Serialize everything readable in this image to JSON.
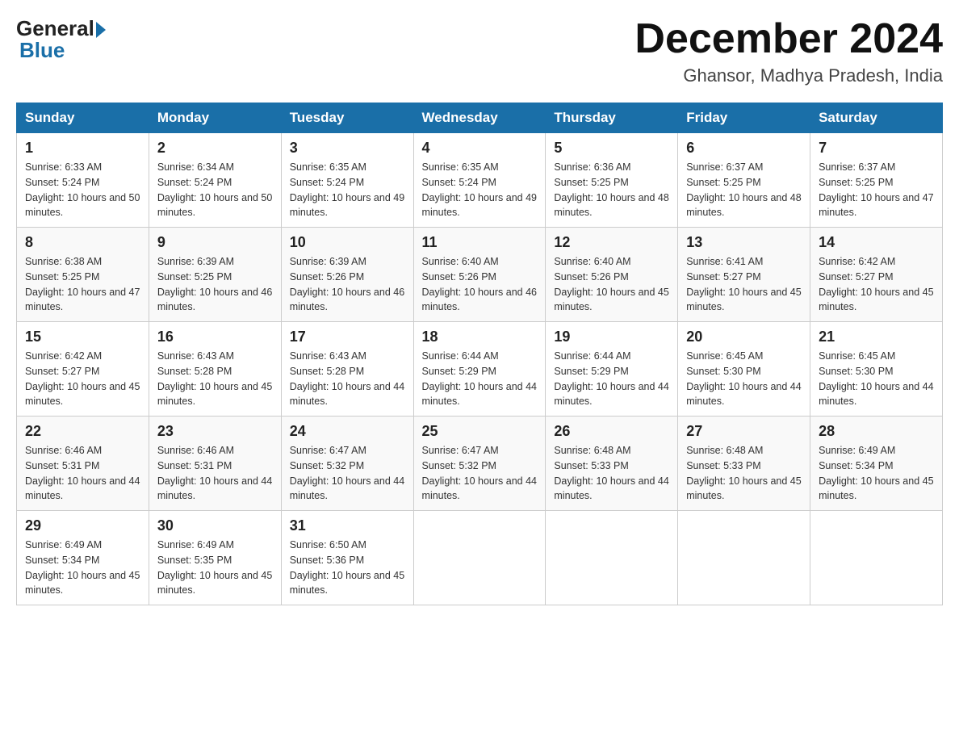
{
  "logo": {
    "general": "General",
    "blue": "Blue"
  },
  "title": "December 2024",
  "location": "Ghansor, Madhya Pradesh, India",
  "headers": [
    "Sunday",
    "Monday",
    "Tuesday",
    "Wednesday",
    "Thursday",
    "Friday",
    "Saturday"
  ],
  "weeks": [
    [
      {
        "day": "1",
        "sunrise": "6:33 AM",
        "sunset": "5:24 PM",
        "daylight": "10 hours and 50 minutes."
      },
      {
        "day": "2",
        "sunrise": "6:34 AM",
        "sunset": "5:24 PM",
        "daylight": "10 hours and 50 minutes."
      },
      {
        "day": "3",
        "sunrise": "6:35 AM",
        "sunset": "5:24 PM",
        "daylight": "10 hours and 49 minutes."
      },
      {
        "day": "4",
        "sunrise": "6:35 AM",
        "sunset": "5:24 PM",
        "daylight": "10 hours and 49 minutes."
      },
      {
        "day": "5",
        "sunrise": "6:36 AM",
        "sunset": "5:25 PM",
        "daylight": "10 hours and 48 minutes."
      },
      {
        "day": "6",
        "sunrise": "6:37 AM",
        "sunset": "5:25 PM",
        "daylight": "10 hours and 48 minutes."
      },
      {
        "day": "7",
        "sunrise": "6:37 AM",
        "sunset": "5:25 PM",
        "daylight": "10 hours and 47 minutes."
      }
    ],
    [
      {
        "day": "8",
        "sunrise": "6:38 AM",
        "sunset": "5:25 PM",
        "daylight": "10 hours and 47 minutes."
      },
      {
        "day": "9",
        "sunrise": "6:39 AM",
        "sunset": "5:25 PM",
        "daylight": "10 hours and 46 minutes."
      },
      {
        "day": "10",
        "sunrise": "6:39 AM",
        "sunset": "5:26 PM",
        "daylight": "10 hours and 46 minutes."
      },
      {
        "day": "11",
        "sunrise": "6:40 AM",
        "sunset": "5:26 PM",
        "daylight": "10 hours and 46 minutes."
      },
      {
        "day": "12",
        "sunrise": "6:40 AM",
        "sunset": "5:26 PM",
        "daylight": "10 hours and 45 minutes."
      },
      {
        "day": "13",
        "sunrise": "6:41 AM",
        "sunset": "5:27 PM",
        "daylight": "10 hours and 45 minutes."
      },
      {
        "day": "14",
        "sunrise": "6:42 AM",
        "sunset": "5:27 PM",
        "daylight": "10 hours and 45 minutes."
      }
    ],
    [
      {
        "day": "15",
        "sunrise": "6:42 AM",
        "sunset": "5:27 PM",
        "daylight": "10 hours and 45 minutes."
      },
      {
        "day": "16",
        "sunrise": "6:43 AM",
        "sunset": "5:28 PM",
        "daylight": "10 hours and 45 minutes."
      },
      {
        "day": "17",
        "sunrise": "6:43 AM",
        "sunset": "5:28 PM",
        "daylight": "10 hours and 44 minutes."
      },
      {
        "day": "18",
        "sunrise": "6:44 AM",
        "sunset": "5:29 PM",
        "daylight": "10 hours and 44 minutes."
      },
      {
        "day": "19",
        "sunrise": "6:44 AM",
        "sunset": "5:29 PM",
        "daylight": "10 hours and 44 minutes."
      },
      {
        "day": "20",
        "sunrise": "6:45 AM",
        "sunset": "5:30 PM",
        "daylight": "10 hours and 44 minutes."
      },
      {
        "day": "21",
        "sunrise": "6:45 AM",
        "sunset": "5:30 PM",
        "daylight": "10 hours and 44 minutes."
      }
    ],
    [
      {
        "day": "22",
        "sunrise": "6:46 AM",
        "sunset": "5:31 PM",
        "daylight": "10 hours and 44 minutes."
      },
      {
        "day": "23",
        "sunrise": "6:46 AM",
        "sunset": "5:31 PM",
        "daylight": "10 hours and 44 minutes."
      },
      {
        "day": "24",
        "sunrise": "6:47 AM",
        "sunset": "5:32 PM",
        "daylight": "10 hours and 44 minutes."
      },
      {
        "day": "25",
        "sunrise": "6:47 AM",
        "sunset": "5:32 PM",
        "daylight": "10 hours and 44 minutes."
      },
      {
        "day": "26",
        "sunrise": "6:48 AM",
        "sunset": "5:33 PM",
        "daylight": "10 hours and 44 minutes."
      },
      {
        "day": "27",
        "sunrise": "6:48 AM",
        "sunset": "5:33 PM",
        "daylight": "10 hours and 45 minutes."
      },
      {
        "day": "28",
        "sunrise": "6:49 AM",
        "sunset": "5:34 PM",
        "daylight": "10 hours and 45 minutes."
      }
    ],
    [
      {
        "day": "29",
        "sunrise": "6:49 AM",
        "sunset": "5:34 PM",
        "daylight": "10 hours and 45 minutes."
      },
      {
        "day": "30",
        "sunrise": "6:49 AM",
        "sunset": "5:35 PM",
        "daylight": "10 hours and 45 minutes."
      },
      {
        "day": "31",
        "sunrise": "6:50 AM",
        "sunset": "5:36 PM",
        "daylight": "10 hours and 45 minutes."
      },
      null,
      null,
      null,
      null
    ]
  ],
  "labels": {
    "sunrise_prefix": "Sunrise: ",
    "sunset_prefix": "Sunset: ",
    "daylight_prefix": "Daylight: "
  }
}
